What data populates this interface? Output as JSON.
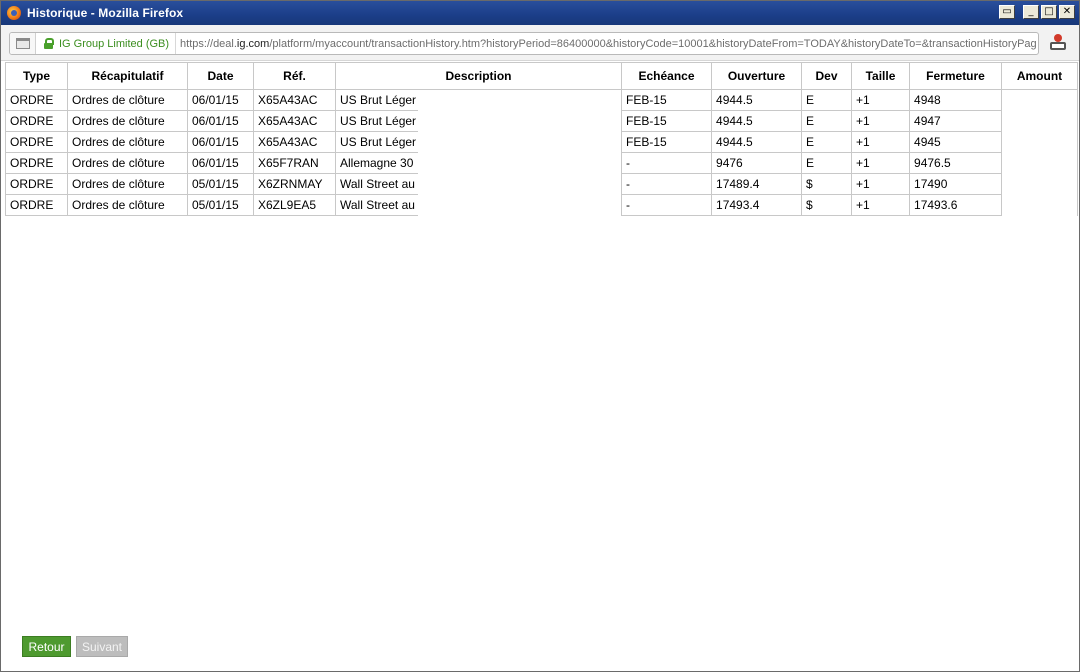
{
  "window": {
    "title": "Historique - Mozilla Firefox",
    "controls": {
      "restore": "▭",
      "minimize": "_",
      "maximize": "□",
      "close": "✕"
    }
  },
  "address_bar": {
    "identity": "IG Group Limited (GB)",
    "url_prefix": "https://deal.",
    "url_domain": "ig.com",
    "url_rest": "/platform/myaccount/transactionHistory.htm?historyPeriod=86400000&historyCode=10001&historyDateFrom=TODAY&historyDateTo=&transactionHistoryPag"
  },
  "table": {
    "headers": [
      "Type",
      "Récapitulatif",
      "Date",
      "Réf.",
      "Description",
      "Echéance",
      "Ouverture",
      "Dev",
      "Taille",
      "Fermeture",
      "Amount"
    ],
    "rows": [
      [
        "ORDRE",
        "Ordres de clôture",
        "06/01/15",
        "X65A43AC",
        "US Brut Léger",
        "FEB-15",
        "4944.5",
        "E",
        "+1",
        "4948"
      ],
      [
        "ORDRE",
        "Ordres de clôture",
        "06/01/15",
        "X65A43AC",
        "US Brut Léger",
        "FEB-15",
        "4944.5",
        "E",
        "+1",
        "4947"
      ],
      [
        "ORDRE",
        "Ordres de clôture",
        "06/01/15",
        "X65A43AC",
        "US Brut Léger",
        "FEB-15",
        "4944.5",
        "E",
        "+1",
        "4945"
      ],
      [
        "ORDRE",
        "Ordres de clôture",
        "06/01/15",
        "X65F7RAN",
        "Allemagne 30",
        "-",
        "9476",
        "E",
        "+1",
        "9476.5"
      ],
      [
        "ORDRE",
        "Ordres de clôture",
        "05/01/15",
        "X6ZRNMAY",
        "Wall Street au",
        "-",
        "17489.4",
        "$",
        "+1",
        "17490"
      ],
      [
        "ORDRE",
        "Ordres de clôture",
        "05/01/15",
        "X6ZL9EA5",
        "Wall Street au",
        "-",
        "17493.4",
        "$",
        "+1",
        "17493.6"
      ]
    ]
  },
  "buttons": {
    "back": "Retour",
    "next": "Suivant"
  },
  "colors": {
    "titlebar": "#1c3f8a",
    "identity_green": "#3b8e1f",
    "back_button": "#4e9a2f",
    "next_button_disabled": "#bdbdbd"
  }
}
